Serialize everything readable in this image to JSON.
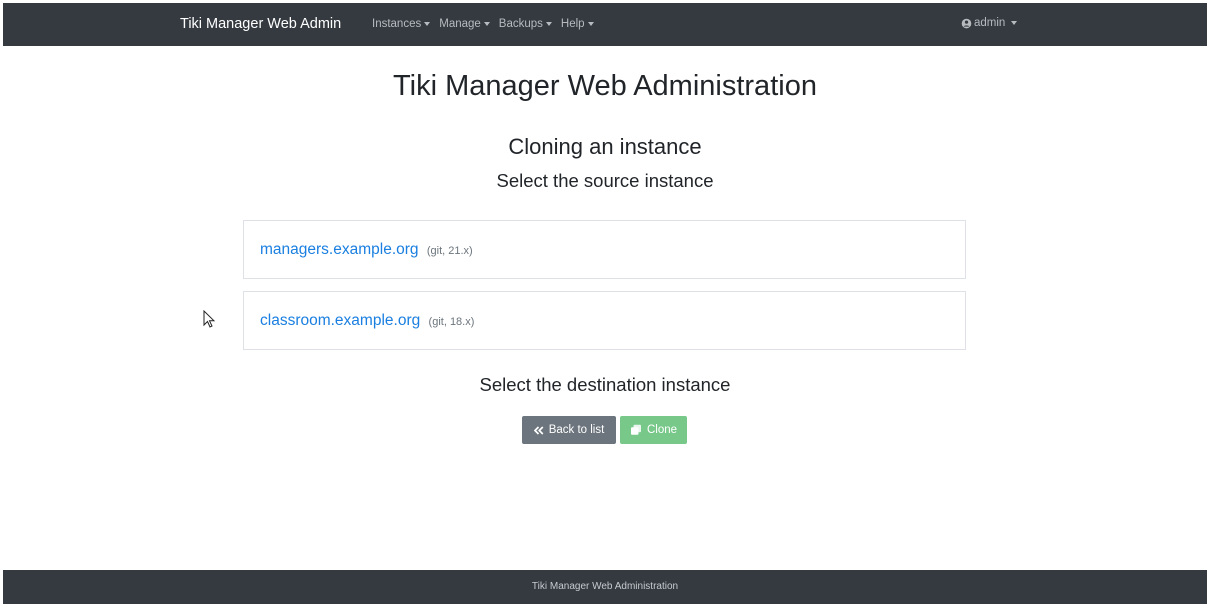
{
  "navbar": {
    "brand": "Tiki Manager Web Admin",
    "menus": [
      {
        "label": "Instances"
      },
      {
        "label": "Manage"
      },
      {
        "label": "Backups"
      },
      {
        "label": "Help"
      }
    ],
    "user": {
      "label": "admin",
      "icon": "user-circle-icon"
    }
  },
  "main": {
    "title": "Tiki Manager Web Administration",
    "section_title": "Cloning an instance",
    "source_subtitle": "Select the source instance",
    "instances": [
      {
        "name": "managers.example.org",
        "meta": "(git, 21.x)"
      },
      {
        "name": "classroom.example.org",
        "meta": "(git, 18.x)"
      }
    ],
    "destination_subtitle": "Select the destination instance",
    "buttons": {
      "back_label": "Back to list",
      "back_icon": "double-chevron-left-icon",
      "clone_label": "Clone",
      "clone_icon": "clone-icon"
    }
  },
  "footer": {
    "text": "Tiki Manager Web Administration"
  },
  "colors": {
    "navbar_bg": "#343a40",
    "link": "#1a7fe0",
    "secondary_button": "#6c757d",
    "success_button": "#78c88a"
  }
}
